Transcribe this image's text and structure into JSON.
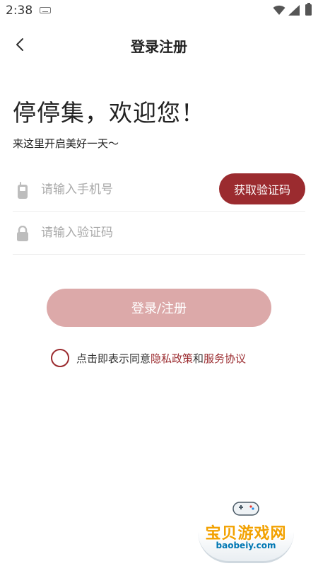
{
  "status_bar": {
    "time": "2:38"
  },
  "header": {
    "title": "登录注册"
  },
  "welcome": {
    "title": "停停集，欢迎您！",
    "subtitle": "来这里开启美好一天～"
  },
  "phone_field": {
    "placeholder": "请输入手机号",
    "value": ""
  },
  "code_button": {
    "label": "获取验证码"
  },
  "code_field": {
    "placeholder": "请输入验证码",
    "value": ""
  },
  "submit_button": {
    "label": "登录/注册"
  },
  "agreement": {
    "checked": false,
    "prefix": "点击即表示同意",
    "privacy_link": "隐私政策",
    "conjunction": "和",
    "service_link": "服务协议"
  },
  "watermark": {
    "name": "宝贝游戏网",
    "domain": "baobeiy.com"
  },
  "colors": {
    "accent": "#9b2b2f",
    "submit_disabled": "#dca9a9",
    "placeholder": "#aaaaaa",
    "divider": "#ededed"
  },
  "icons": {
    "back": "chevron-left-icon",
    "phone": "mobile-phone-icon",
    "lock": "lock-icon",
    "wifi": "wifi-icon",
    "signal": "signal-icon",
    "battery": "battery-icon",
    "keyboard": "keyboard-icon"
  }
}
